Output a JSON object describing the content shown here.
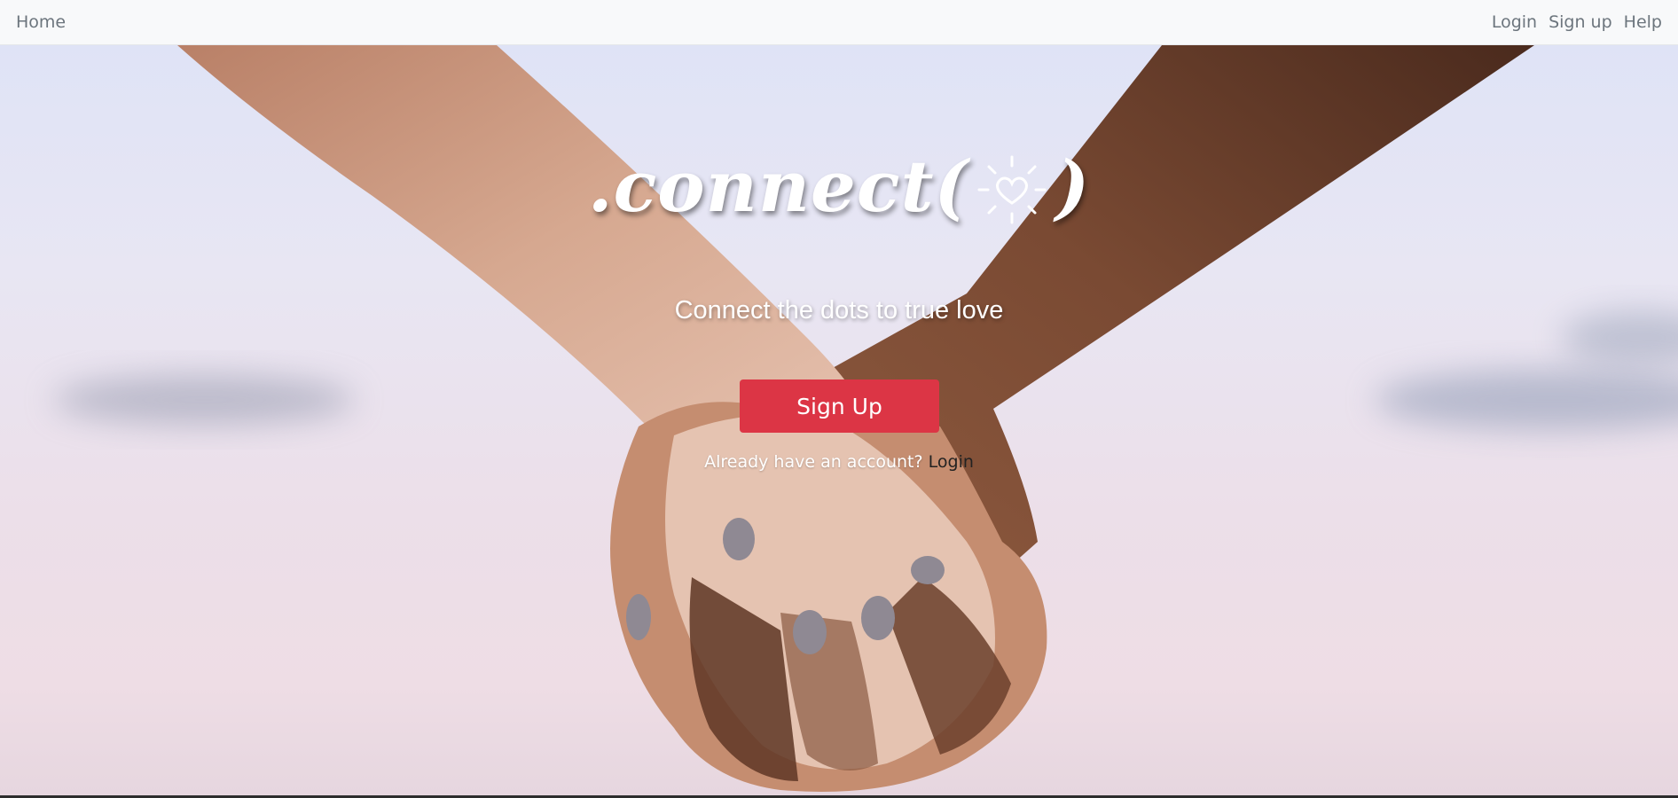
{
  "navbar": {
    "home_label": "Home",
    "login_label": "Login",
    "signup_label": "Sign up",
    "help_label": "Help"
  },
  "hero": {
    "logo_text": ".connect(",
    "logo_close": ")",
    "logo_icon": "heart-sun-icon",
    "tagline": "Connect the dots to true love",
    "signup_button_label": "Sign Up",
    "account_prompt": "Already have an account?",
    "login_link_label": "Login"
  },
  "colors": {
    "accent": "#dc3545",
    "navbar_bg": "#f8f9fa",
    "nav_text": "#6c757d"
  }
}
